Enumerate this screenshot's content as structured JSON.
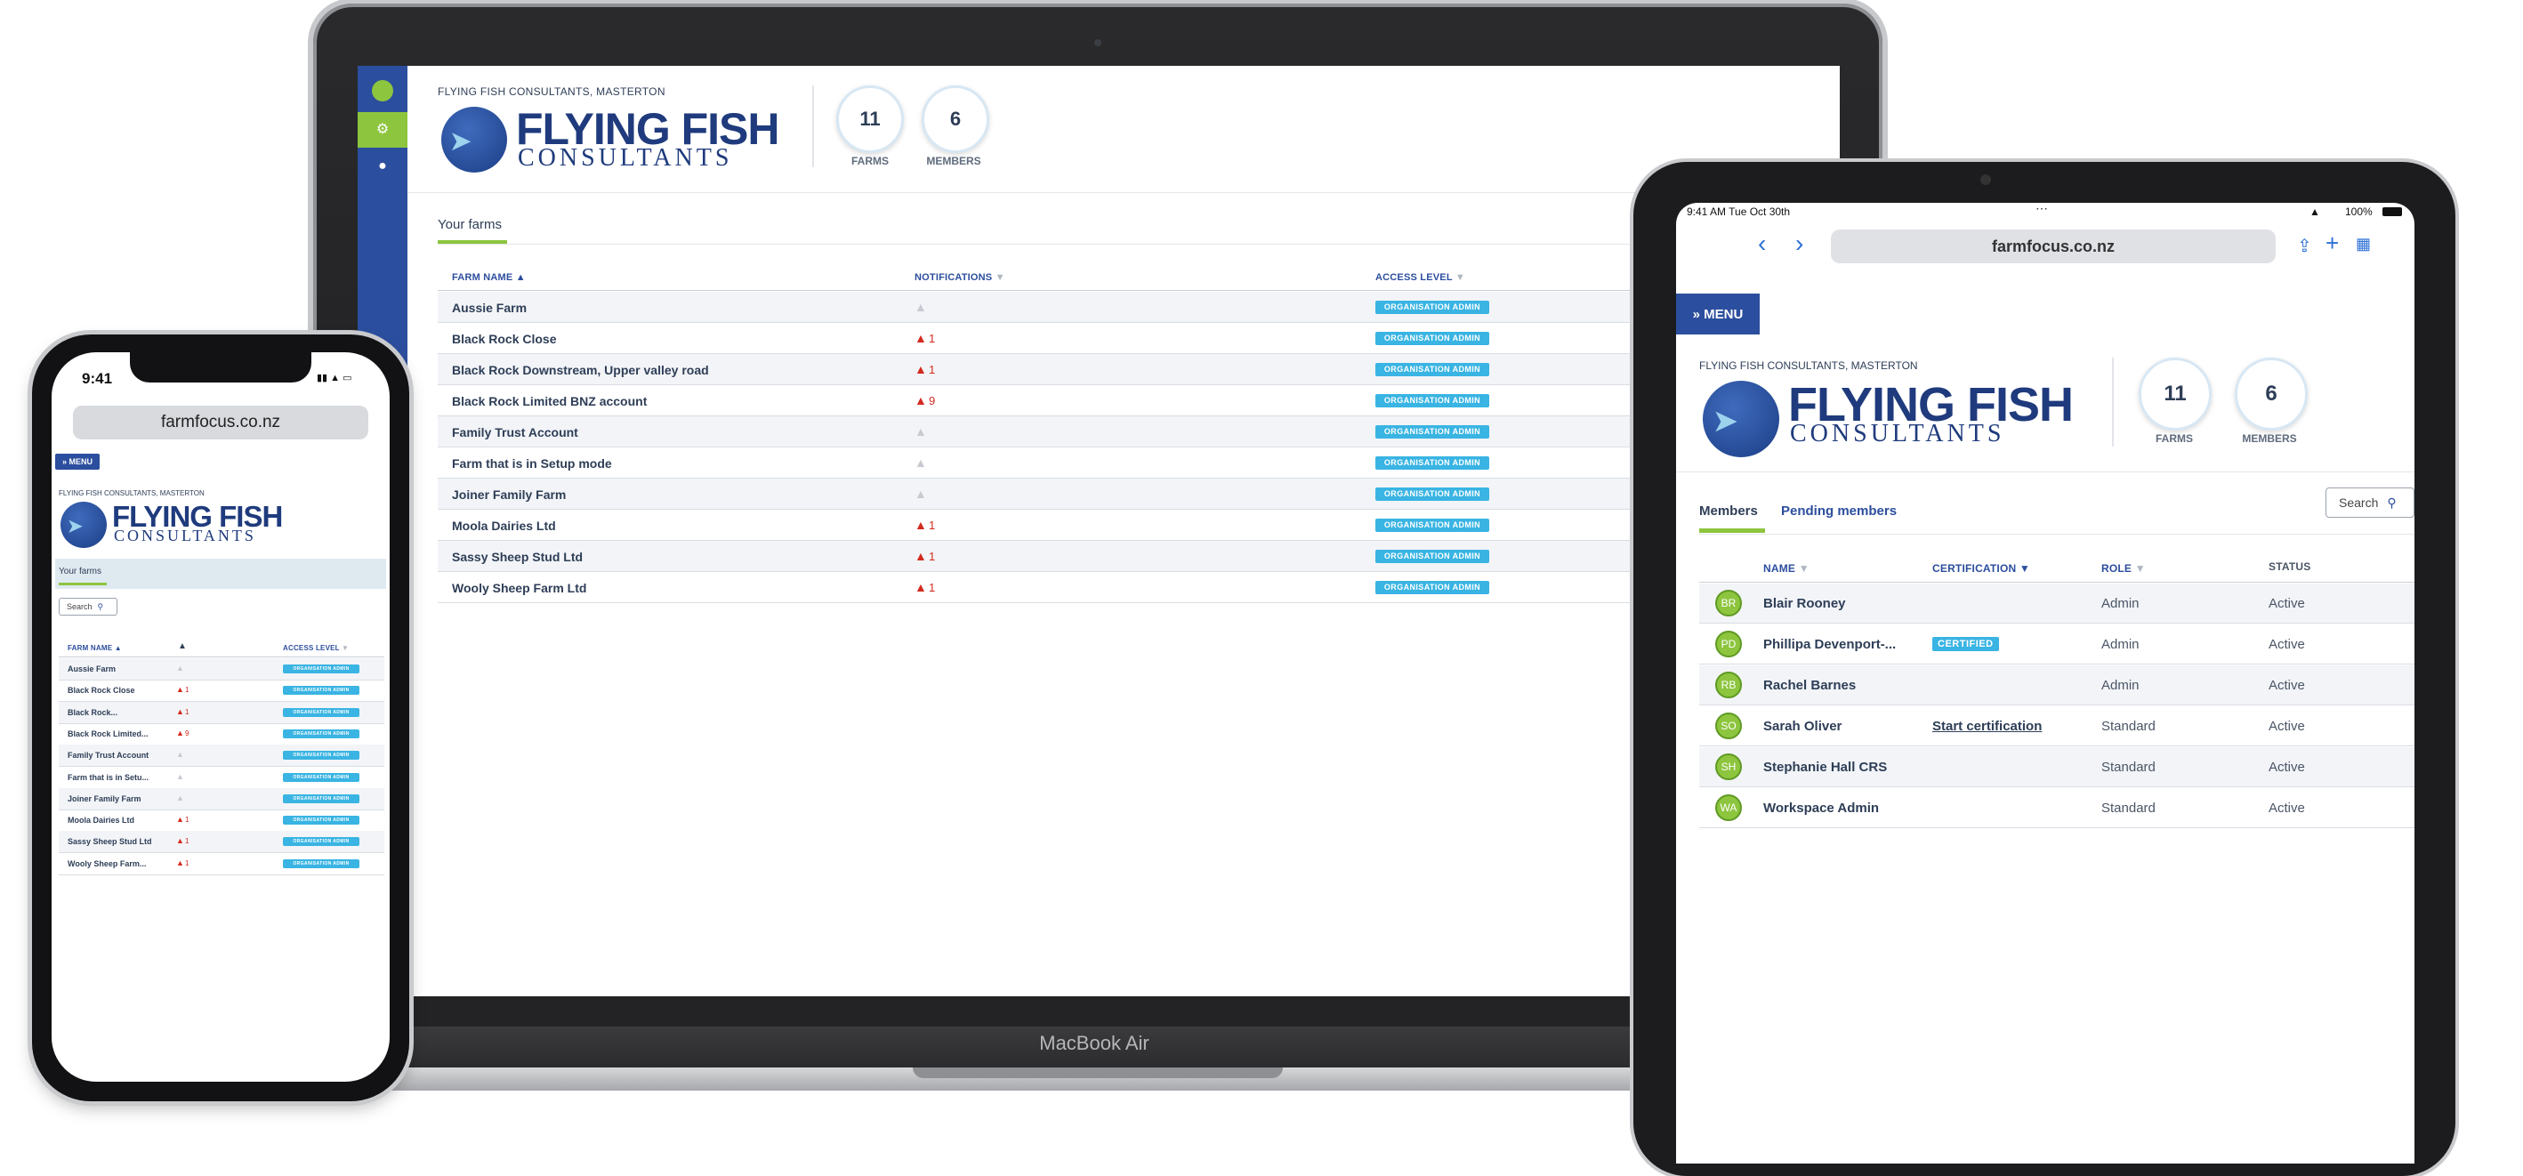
{
  "laptop": {
    "brand": "MacBook Air",
    "breadcrumb": "FLYING FISH CONSULTANTS, MASTERTON",
    "logo": {
      "line1": "FLYING FISH",
      "line2": "CONSULTANTS"
    },
    "stats": [
      {
        "value": "11",
        "label": "FARMS"
      },
      {
        "value": "6",
        "label": "MEMBERS"
      }
    ],
    "tab": "Your farms",
    "columns": {
      "name": "FARM NAME",
      "notifications": "NOTIFICATIONS",
      "access": "ACCESS LEVEL"
    },
    "rows": [
      {
        "name": "Aussie Farm",
        "count": "",
        "access": "ORGANISATION ADMIN"
      },
      {
        "name": "Black Rock Close",
        "count": "1",
        "access": "ORGANISATION ADMIN"
      },
      {
        "name": "Black Rock Downstream, Upper valley road",
        "count": "1",
        "access": "ORGANISATION ADMIN"
      },
      {
        "name": "Black Rock Limited BNZ account",
        "count": "9",
        "access": "ORGANISATION ADMIN"
      },
      {
        "name": "Family Trust Account",
        "count": "",
        "access": "ORGANISATION ADMIN"
      },
      {
        "name": "Farm that is in Setup mode",
        "count": "",
        "access": "ORGANISATION ADMIN"
      },
      {
        "name": "Joiner Family Farm",
        "count": "",
        "access": "ORGANISATION ADMIN"
      },
      {
        "name": "Moola Dairies Ltd",
        "count": "1",
        "access": "ORGANISATION ADMIN"
      },
      {
        "name": "Sassy Sheep Stud Ltd",
        "count": "1",
        "access": "ORGANISATION ADMIN"
      },
      {
        "name": "Wooly Sheep Farm Ltd",
        "count": "1",
        "access": "ORGANISATION ADMIN"
      }
    ]
  },
  "phone": {
    "time": "9:41",
    "url": "farmfocus.co.nz",
    "menu": "MENU",
    "breadcrumb": "FLYING FISH CONSULTANTS, MASTERTON",
    "logo": {
      "line1": "FLYING FISH",
      "line2": "CONSULTANTS"
    },
    "tab": "Your farms",
    "search": "Search",
    "columns": {
      "name": "FARM NAME",
      "access": "ACCESS LEVEL"
    },
    "rows": [
      {
        "name": "Aussie Farm",
        "count": "",
        "access": "ORGANISATION ADMIN"
      },
      {
        "name": "Black Rock Close",
        "count": "1",
        "access": "ORGANISATION ADMIN"
      },
      {
        "name": "Black Rock...",
        "count": "1",
        "access": "ORGANISATION ADMIN"
      },
      {
        "name": "Black Rock Limited...",
        "count": "9",
        "access": "ORGANISATION ADMIN"
      },
      {
        "name": "Family Trust Account",
        "count": "",
        "access": "ORGANISATION ADMIN"
      },
      {
        "name": "Farm that is in Setu...",
        "count": "",
        "access": "ORGANISATION ADMIN"
      },
      {
        "name": "Joiner Family Farm",
        "count": "",
        "access": "ORGANISATION ADMIN"
      },
      {
        "name": "Moola Dairies Ltd",
        "count": "1",
        "access": "ORGANISATION ADMIN"
      },
      {
        "name": "Sassy Sheep Stud Ltd",
        "count": "1",
        "access": "ORGANISATION ADMIN"
      },
      {
        "name": "Wooly Sheep Farm...",
        "count": "1",
        "access": "ORGANISATION ADMIN"
      }
    ]
  },
  "tablet": {
    "time": "9:41 AM  Tue Oct 30th",
    "battery": "100%",
    "url": "farmfocus.co.nz",
    "menu": "MENU",
    "breadcrumb": "FLYING FISH CONSULTANTS, MASTERTON",
    "logo": {
      "line1": "FLYING FISH",
      "line2": "CONSULTANTS"
    },
    "stats": [
      {
        "value": "11",
        "label": "FARMS"
      },
      {
        "value": "6",
        "label": "MEMBERS"
      }
    ],
    "tabs": [
      "Members",
      "Pending members"
    ],
    "search": "Search",
    "columns": {
      "name": "NAME",
      "certification": "CERTIFICATION",
      "role": "ROLE",
      "status": "STATUS"
    },
    "rows": [
      {
        "initials": "BR",
        "name": "Blair Rooney",
        "cert": "",
        "role": "Admin",
        "status": "Active"
      },
      {
        "initials": "PD",
        "name": "Phillipa Devenport-...",
        "cert": "CERTIFIED",
        "role": "Admin",
        "status": "Active"
      },
      {
        "initials": "RB",
        "name": "Rachel Barnes",
        "cert": "",
        "role": "Admin",
        "status": "Active"
      },
      {
        "initials": "SO",
        "name": "Sarah Oliver",
        "cert": "Start certification",
        "role": "Standard",
        "status": "Active"
      },
      {
        "initials": "SH",
        "name": "Stephanie Hall CRS",
        "cert": "",
        "role": "Standard",
        "status": "Active"
      },
      {
        "initials": "WA",
        "name": "Workspace Admin",
        "cert": "",
        "role": "Standard",
        "status": "Active"
      }
    ]
  },
  "colors": {
    "brand_blue": "#2c4e9e",
    "accent_green": "#8dc53e",
    "badge_cyan": "#39b4e3",
    "alert_red": "#d32a1f"
  }
}
